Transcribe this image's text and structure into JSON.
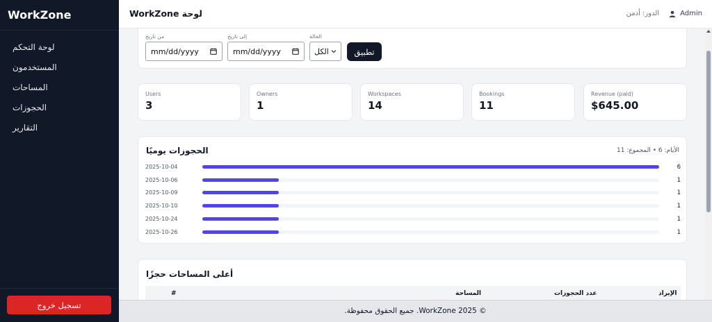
{
  "brand": "WorkZone",
  "sidebar": {
    "items": [
      {
        "label": "لوحة التحكم"
      },
      {
        "label": "المستخدمون"
      },
      {
        "label": "المساحات"
      },
      {
        "label": "الحجوزات"
      },
      {
        "label": "التقارير"
      }
    ],
    "logout_label": "تسجيل خروج"
  },
  "header": {
    "title": "لوحة WorkZone",
    "role": "الدور: أدمن",
    "user": "Admin"
  },
  "filters": {
    "from_label": "من تاريخ",
    "from_value": "mm/dd/yyyy",
    "to_label": "إلى تاريخ",
    "to_value": "mm/dd/yyyy",
    "status_label": "الحالة",
    "status_value": "الكل",
    "apply_label": "تطبيق"
  },
  "stats": [
    {
      "label": "Users",
      "value": "3"
    },
    {
      "label": "Owners",
      "value": "1"
    },
    {
      "label": "Workspaces",
      "value": "14"
    },
    {
      "label": "Bookings",
      "value": "11"
    },
    {
      "label": "Revenue (paid)",
      "value": "$645.00"
    }
  ],
  "daily": {
    "title": "الحجوزات يوميًا",
    "meta": "الأيام: 6 • المجموع: 11",
    "max": 6,
    "rows": [
      {
        "date": "2025-10-04",
        "count": 6
      },
      {
        "date": "2025-10-06",
        "count": 1
      },
      {
        "date": "2025-10-09",
        "count": 1
      },
      {
        "date": "2025-10-10",
        "count": 1
      },
      {
        "date": "2025-10-24",
        "count": 1
      },
      {
        "date": "2025-10-26",
        "count": 1
      }
    ]
  },
  "top_spaces": {
    "title": "أعلى المساحات حجزًا",
    "columns": {
      "index": "#",
      "space": "المساحة",
      "bookings": "عدد الحجوزات",
      "revenue": "الإيراد"
    }
  },
  "footer": "© 2025 WorkZone. جميع الحقوق محفوظة.",
  "colors": {
    "sidebar": "#111827",
    "accent": "#4f46e5",
    "danger": "#dc2626"
  }
}
